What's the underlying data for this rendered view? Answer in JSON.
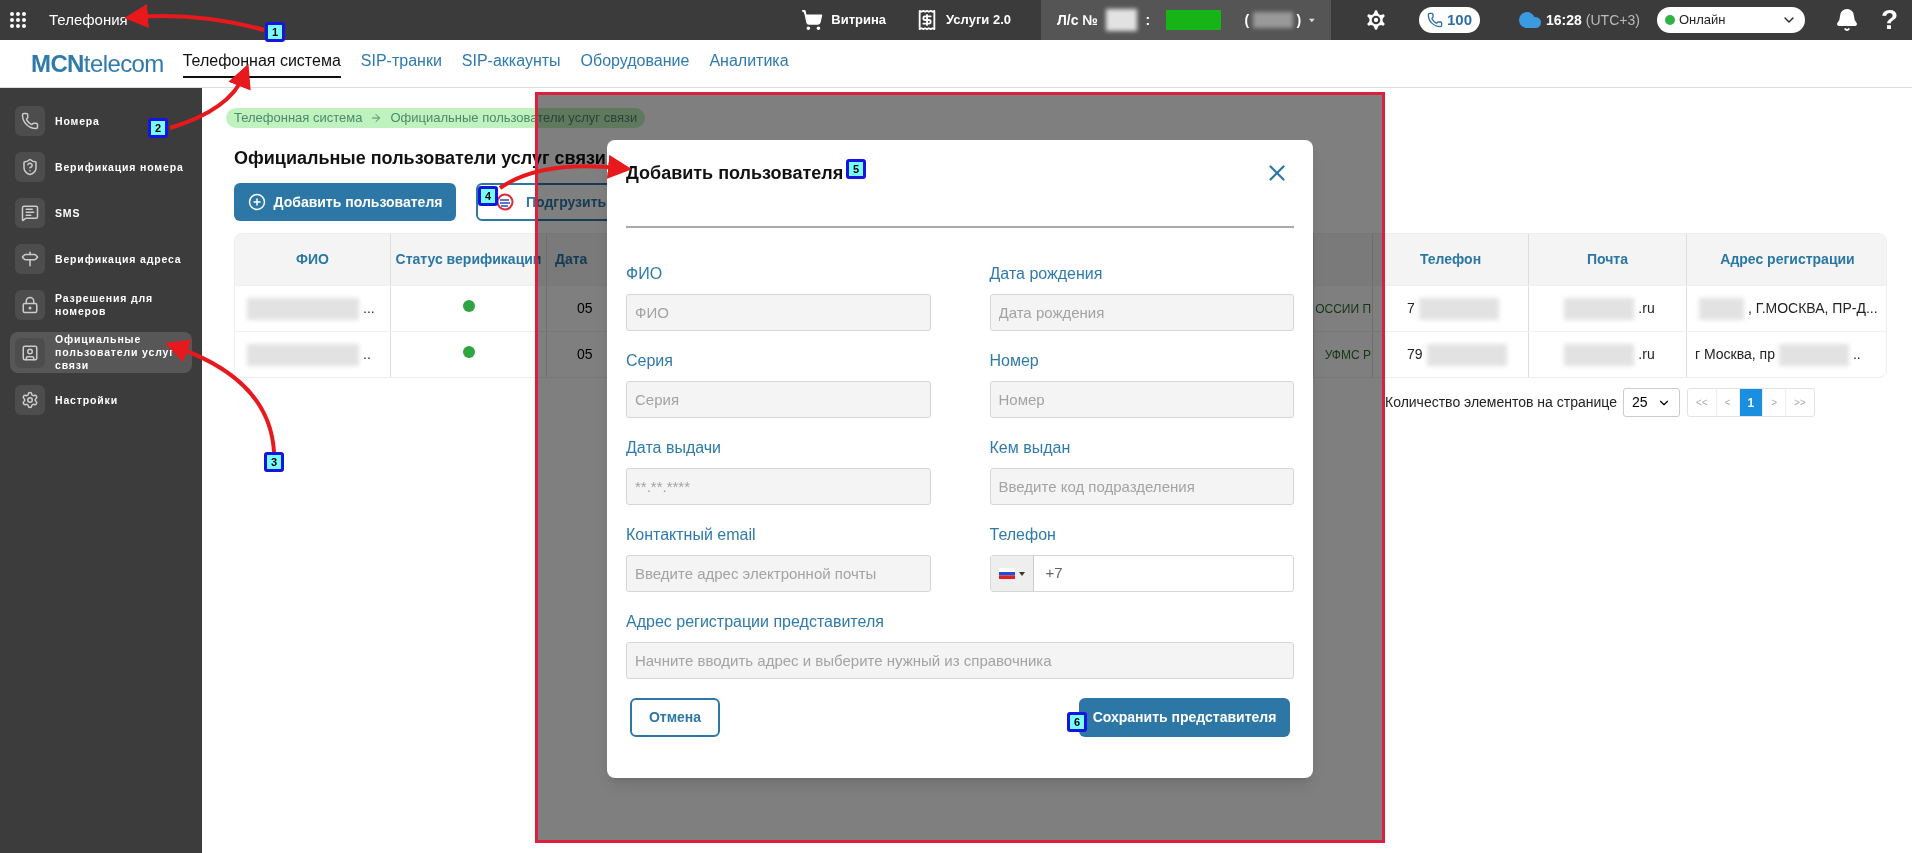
{
  "top_bar": {
    "app_title": "Телефония",
    "links": [
      {
        "label": "Витрина"
      },
      {
        "label": "Услуги 2.0"
      }
    ],
    "account": {
      "prefix": "Л/с №",
      "separator": ":",
      "open_paren": "(",
      "close_paren": ")",
      "redacted": true
    },
    "calls": "100",
    "time": "16:28",
    "timezone": "(UTC+3)",
    "status": {
      "label": "Онлайн",
      "color": "#2fb344"
    },
    "help": "?"
  },
  "brand": {
    "bold": "MCN",
    "light": "telecom"
  },
  "nav_tabs": [
    {
      "label": "Телефонная система",
      "selected": true
    },
    {
      "label": "SIP-транки",
      "selected": false
    },
    {
      "label": "SIP-аккаунты",
      "selected": false
    },
    {
      "label": "Оборудование",
      "selected": false
    },
    {
      "label": "Аналитика",
      "selected": false
    }
  ],
  "sidebar": {
    "items": [
      {
        "label": "Номера",
        "selected": false
      },
      {
        "label": "Верификация номера",
        "selected": false
      },
      {
        "label": "SMS",
        "selected": false
      },
      {
        "label": "Верификация адреса",
        "selected": false
      },
      {
        "label": "Разрешения для номеров",
        "selected": false
      },
      {
        "label": "Официальные пользователи услуг связи",
        "selected": true
      },
      {
        "label": "Настройки",
        "selected": false
      }
    ]
  },
  "breadcrumb": [
    "Телефонная система",
    "Официальные пользователи услуг связи"
  ],
  "page_title": "Официальные пользователи услуг связи",
  "actions": [
    {
      "label": "Добавить пользователя",
      "kind": "primary"
    },
    {
      "label": "Подгрузить",
      "kind": "outline"
    }
  ],
  "table": {
    "columns": [
      "ФИО",
      "Статус верификации",
      "Дата",
      "",
      "",
      "Телефон",
      "Почта",
      "Адрес регистрации"
    ],
    "rows": [
      {
        "fio": {
          "after": "...",
          "redacted": true
        },
        "status": {
          "color": "#2ea443"
        },
        "date": "05",
        "column_5": "ОССИИ П",
        "phone": {
          "before": "7",
          "redacted": true
        },
        "email": {
          "after": ".ru",
          "redacted": true
        },
        "address": {
          "after": ", Г.МОСКВА, ПР-Д...",
          "redacted": true
        }
      },
      {
        "fio": {
          "after": "..",
          "redacted": true
        },
        "status": {
          "color": "#2ea443"
        },
        "date": "05",
        "column_5": "УФМС Р",
        "phone": {
          "before": "79",
          "redacted": true
        },
        "email": {
          "after": ".ru",
          "redacted": true
        },
        "address": {
          "before": "г Москва, пр",
          "after": "..",
          "redacted": true
        }
      }
    ]
  },
  "pagination": {
    "label": "Количество элементов на странице",
    "page_size": "25",
    "pages": [
      {
        "label": "<<",
        "selected": false
      },
      {
        "label": "<",
        "selected": false
      },
      {
        "label": "1",
        "selected": true
      },
      {
        "label": ">",
        "selected": false
      },
      {
        "label": ">>",
        "selected": false
      }
    ]
  },
  "modal": {
    "title": "Добавить пользователя",
    "fields": [
      {
        "label": "ФИО",
        "placeholder": "ФИО",
        "kind": "text"
      },
      {
        "label": "Дата рождения",
        "placeholder": "Дата рождения",
        "kind": "text"
      },
      {
        "label": "Серия",
        "placeholder": "Серия",
        "kind": "text"
      },
      {
        "label": "Номер",
        "placeholder": "Номер",
        "kind": "text"
      },
      {
        "label": "Дата выдачи",
        "placeholder": "**.**.****",
        "kind": "text"
      },
      {
        "label": "Кем выдан",
        "placeholder": "Введите код подразделения",
        "kind": "text"
      },
      {
        "label": "Контактный email",
        "placeholder": "Введите адрес электронной почты",
        "kind": "text"
      },
      {
        "label": "Телефон",
        "placeholder": "+7",
        "kind": "phone"
      },
      {
        "label": "Адрес регистрации представителя",
        "placeholder": "Начните вводить адрес и выберите нужный из справочника",
        "kind": "wide"
      }
    ],
    "cancel": "Отмена",
    "save": "Сохранить представителя"
  },
  "annotations": {
    "badges": [
      "1",
      "2",
      "3",
      "4",
      "5",
      "6"
    ]
  }
}
